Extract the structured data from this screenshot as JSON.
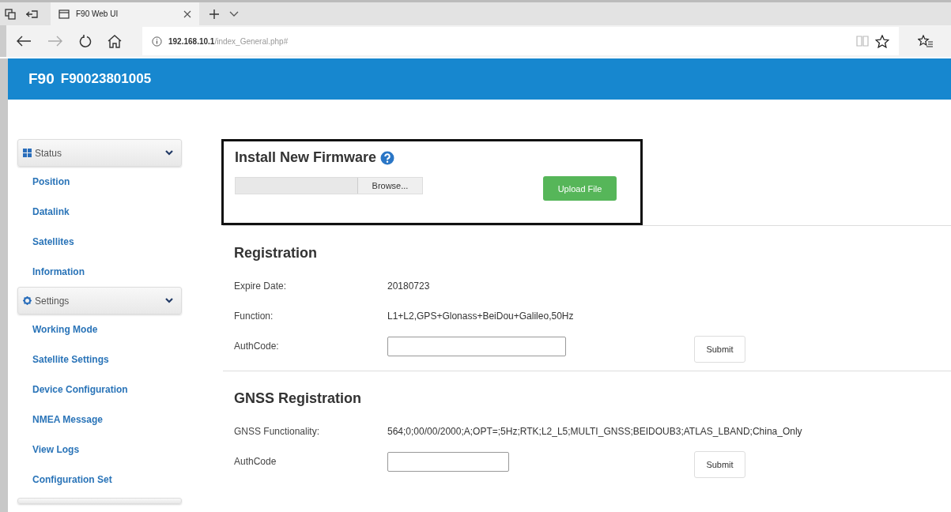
{
  "browser": {
    "tabs": [
      {
        "title": "F90 Web UI",
        "selected": true
      }
    ],
    "url": {
      "host": "192.168.10.1",
      "path": "/index_General.php#"
    }
  },
  "header": {
    "model": "F90",
    "serial": "F90023801005"
  },
  "sidebar": {
    "sections": [
      {
        "label": "Status",
        "expanded": true,
        "items": [
          {
            "label": "Position"
          },
          {
            "label": "Datalink"
          },
          {
            "label": "Satellites"
          },
          {
            "label": "Information"
          }
        ]
      },
      {
        "label": "Settings",
        "expanded": true,
        "items": [
          {
            "label": "Working Mode"
          },
          {
            "label": "Satellite Settings"
          },
          {
            "label": "Device Configuration"
          },
          {
            "label": "NMEA Message"
          },
          {
            "label": "View Logs"
          },
          {
            "label": "Configuration Set"
          }
        ]
      }
    ]
  },
  "firmware": {
    "title": "Install New Firmware",
    "browse_button": "Browse...",
    "upload_button": "Upload File"
  },
  "sections": [
    {
      "title": "Registration",
      "rows": [
        {
          "kind": "text",
          "label": "Expire Date:",
          "value": "20180723"
        },
        {
          "kind": "text",
          "label": "Function:",
          "value": "L1+L2,GPS+Glonass+BeiDou+Galileo,50Hz"
        },
        {
          "kind": "input",
          "label": "AuthCode:",
          "button": "Submit"
        }
      ]
    },
    {
      "title": "GNSS Registration",
      "rows": [
        {
          "kind": "text",
          "label": "GNSS Functionality:",
          "value": "564;0;00/00/2000;A;OPT=;5Hz;RTK;L2_L5;MULTI_GNSS;BEIDOUB3;ATLAS_LBAND;China_Only"
        },
        {
          "kind": "input",
          "label": "AuthCode",
          "button": "Submit"
        }
      ]
    }
  ]
}
